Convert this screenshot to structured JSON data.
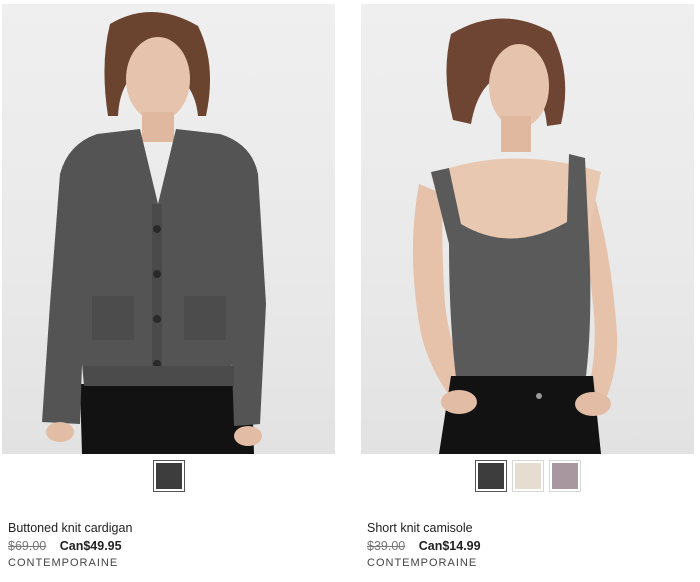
{
  "products": [
    {
      "name": "Buttoned knit cardigan",
      "old_price": "$69.00",
      "sale_price": "Can$49.95",
      "brand": "CONTEMPORAINE",
      "swatches": [
        {
          "color": "#3d3d3d",
          "selected": true
        }
      ]
    },
    {
      "name": "Short knit camisole",
      "old_price": "$39.00",
      "sale_price": "Can$14.99",
      "brand": "CONTEMPORAINE",
      "swatches": [
        {
          "color": "#3d3d3d",
          "selected": true
        },
        {
          "color": "#e6ddd0",
          "selected": false
        },
        {
          "color": "#a8979f",
          "selected": false
        }
      ]
    }
  ]
}
